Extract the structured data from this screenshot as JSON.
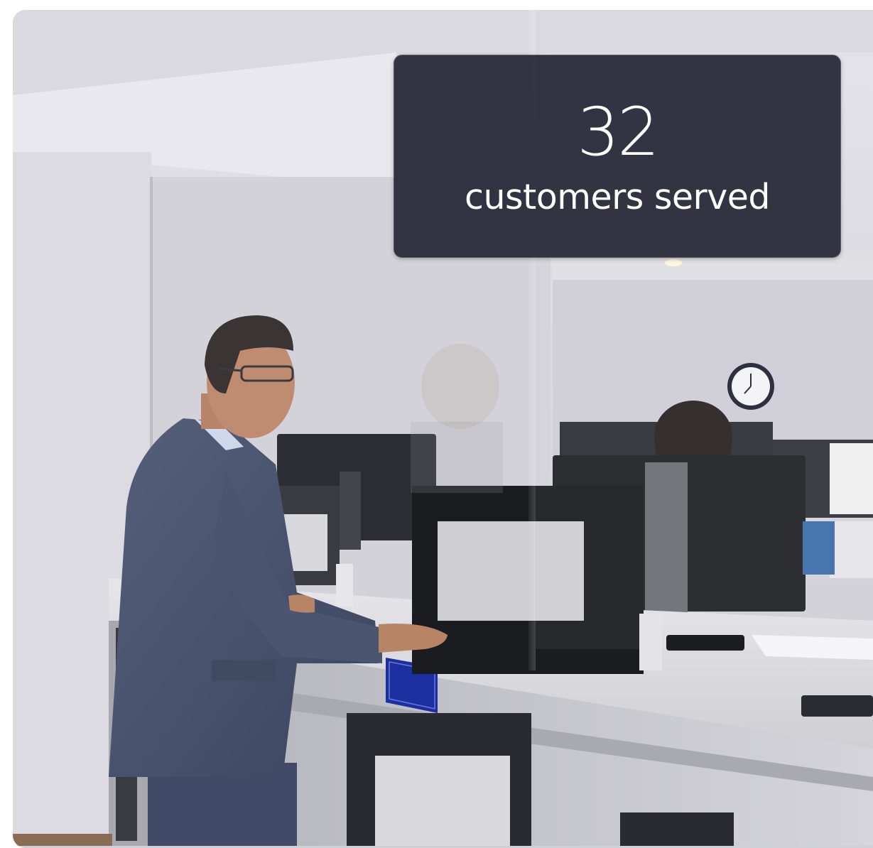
{
  "stat": {
    "value": "32",
    "label": "customers served"
  },
  "colors": {
    "panel_background": "#262736",
    "panel_text": "#ffffff",
    "page_background": "#ffffff"
  }
}
